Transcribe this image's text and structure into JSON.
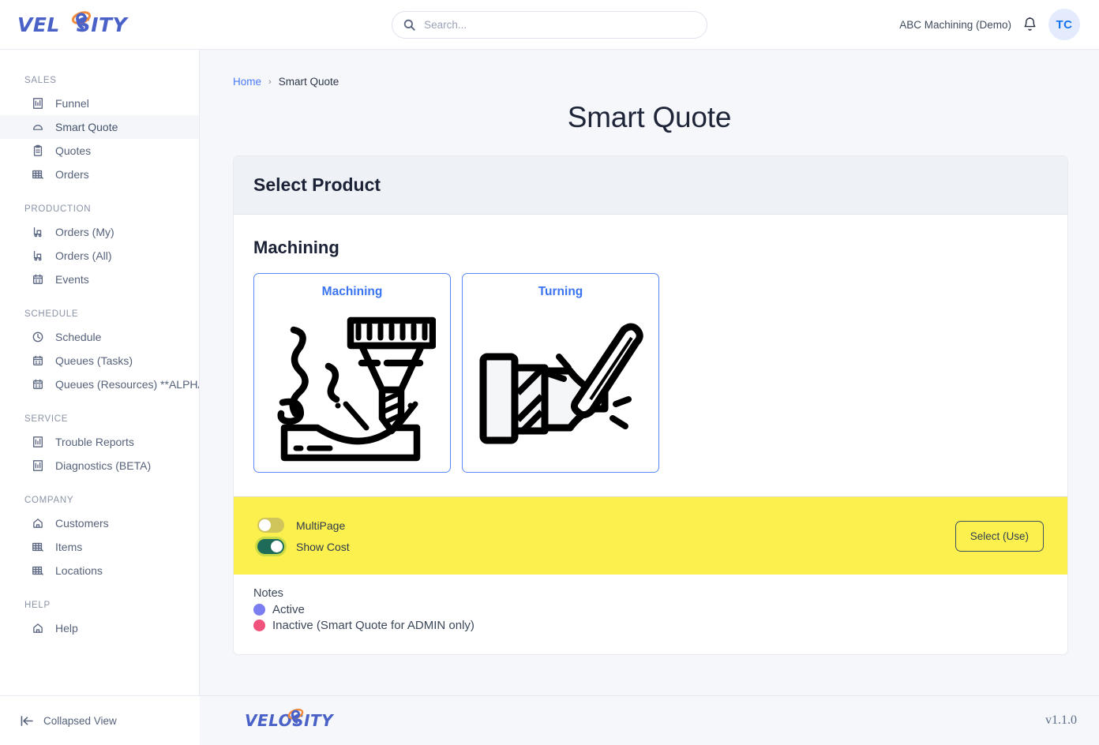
{
  "brand": {
    "logo_text_1": "VEL",
    "logo_text_o": "O",
    "logo_text_2": "SITY",
    "logo_full": "VELOSITY",
    "blue": "#4a62c8",
    "orange": "#f28b3c"
  },
  "header": {
    "search": {
      "placeholder": "Search...",
      "value": "",
      "icon": "search-icon"
    },
    "org_name": "ABC Machining (Demo)",
    "notification_icon": "bell-icon",
    "avatar_initials": "TC"
  },
  "sidebar": {
    "groups": [
      {
        "title": "SALES",
        "items": [
          {
            "label": "Funnel",
            "icon": "chart-building-icon",
            "active": false
          },
          {
            "label": "Smart Quote",
            "icon": "cloud-icon",
            "active": true
          },
          {
            "label": "Quotes",
            "icon": "clipboard-icon",
            "active": false
          },
          {
            "label": "Orders",
            "icon": "grid-truck-icon",
            "active": false
          }
        ]
      },
      {
        "title": "PRODUCTION",
        "items": [
          {
            "label": "Orders (My)",
            "icon": "factory-icon",
            "active": false
          },
          {
            "label": "Orders (All)",
            "icon": "factory-icon",
            "active": false
          },
          {
            "label": "Events",
            "icon": "calendar-icon",
            "active": false
          }
        ]
      },
      {
        "title": "SCHEDULE",
        "items": [
          {
            "label": "Schedule",
            "icon": "clock-icon",
            "active": false
          },
          {
            "label": "Queues (Tasks)",
            "icon": "calendar-icon",
            "active": false
          },
          {
            "label": "Queues (Resources) **ALPHA**",
            "icon": "calendar-icon",
            "active": false
          }
        ]
      },
      {
        "title": "SERVICE",
        "items": [
          {
            "label": "Trouble Reports",
            "icon": "chart-building-icon",
            "active": false
          },
          {
            "label": "Diagnostics (BETA)",
            "icon": "chart-building-icon",
            "active": false
          }
        ]
      },
      {
        "title": "COMPANY",
        "items": [
          {
            "label": "Customers",
            "icon": "home-icon",
            "active": false
          },
          {
            "label": "Items",
            "icon": "grid-truck-icon",
            "active": false
          },
          {
            "label": "Locations",
            "icon": "grid-truck-icon",
            "active": false
          }
        ]
      },
      {
        "title": "HELP",
        "items": [
          {
            "label": "Help",
            "icon": "home-icon",
            "active": false
          }
        ]
      }
    ],
    "collapse_label": "Collapsed View",
    "collapse_icon": "collapse-left-icon"
  },
  "breadcrumb": {
    "home": "Home",
    "separator": "›",
    "current": "Smart Quote"
  },
  "page": {
    "title": "Smart Quote"
  },
  "card": {
    "header": "Select Product",
    "section_title": "Machining",
    "products": [
      {
        "label": "Machining",
        "art": "milling-machine-illustration"
      },
      {
        "label": "Turning",
        "art": "lathe-turning-illustration"
      }
    ]
  },
  "toggle_bar": {
    "background": "#fbf04e",
    "toggles": [
      {
        "label": "MultiPage",
        "on": false
      },
      {
        "label": "Show Cost",
        "on": true
      }
    ],
    "select_button": "Select (Use)"
  },
  "notes": {
    "title": "Notes",
    "items": [
      {
        "label": "Active",
        "color": "#7b7ef0"
      },
      {
        "label": "Inactive (Smart Quote for ADMIN only)",
        "color": "#f2537d"
      }
    ]
  },
  "footer": {
    "version": "v1.1.0"
  }
}
